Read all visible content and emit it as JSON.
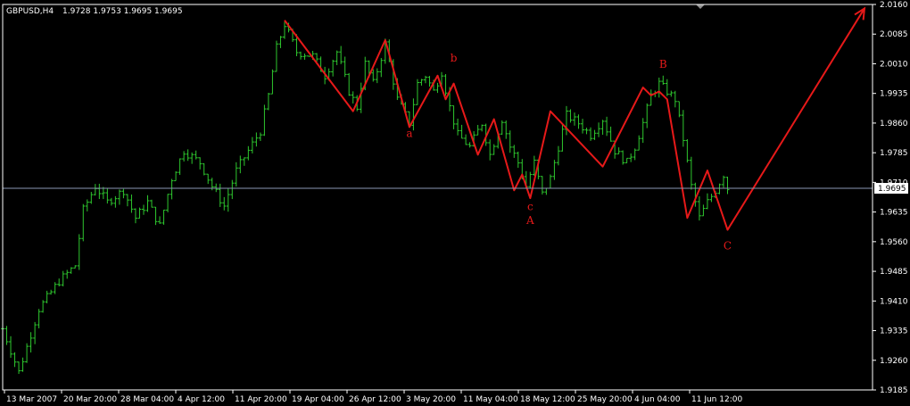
{
  "header": {
    "symbol_tf": "GBPUSD,H4",
    "ohlc": "1.9728 1.9753 1.9695 1.9695"
  },
  "colors": {
    "background": "#000000",
    "bars": "#2ec72e",
    "wave": "#e61919",
    "frame": "#ffffff",
    "bid_line": "#8a96b4",
    "price_box": "#ffffff"
  },
  "chart_data": {
    "type": "ohlc",
    "symbol": "GBPUSD",
    "timeframe": "H4",
    "ylim": [
      1.9185,
      2.016
    ],
    "y_ticks": [
      "2.0160",
      "2.0085",
      "2.0010",
      "1.9935",
      "1.9860",
      "1.9785",
      "1.9710",
      "1.9635",
      "1.9560",
      "1.9485",
      "1.9410",
      "1.9335",
      "1.9260",
      "1.9185"
    ],
    "x_ticks": [
      "13 Mar 2007",
      "20 Mar 20:00",
      "28 Mar 04:00",
      "4 Apr 12:00",
      "11 Apr 20:00",
      "19 Apr 04:00",
      "26 Apr 12:00",
      "3 May 20:00",
      "11 May 04:00",
      "18 May 12:00",
      "25 May 20:00",
      "4 Jun 04:00",
      "11 Jun 12:00"
    ],
    "current_price": 1.9695,
    "current_price_label": "1.9695",
    "price_path": [
      [
        0,
        1.934
      ],
      [
        4,
        1.923
      ],
      [
        9,
        1.939
      ],
      [
        14,
        1.946
      ],
      [
        18,
        1.95
      ],
      [
        20,
        1.964
      ],
      [
        23,
        1.97
      ],
      [
        26,
        1.966
      ],
      [
        30,
        1.969
      ],
      [
        33,
        1.962
      ],
      [
        36,
        1.966
      ],
      [
        39,
        1.96
      ],
      [
        42,
        1.972
      ],
      [
        45,
        1.979
      ],
      [
        49,
        1.976
      ],
      [
        52,
        1.97
      ],
      [
        55,
        1.965
      ],
      [
        58,
        1.974
      ],
      [
        61,
        1.979
      ],
      [
        64,
        1.984
      ],
      [
        66,
        1.993
      ],
      [
        68,
        2.005
      ],
      [
        70,
        2.011
      ],
      [
        73,
        2.004
      ],
      [
        77,
        2.003
      ],
      [
        80,
        1.998
      ],
      [
        83,
        2.004
      ],
      [
        86,
        1.994
      ],
      [
        88,
        1.99
      ],
      [
        90,
        2.001
      ],
      [
        92,
        1.996
      ],
      [
        95,
        2.006
      ],
      [
        98,
        1.992
      ],
      [
        101,
        1.986
      ],
      [
        103,
        1.996
      ],
      [
        105,
        1.998
      ],
      [
        107,
        1.994
      ],
      [
        109,
        1.999
      ],
      [
        111,
        1.99
      ],
      [
        113,
        1.983
      ],
      [
        116,
        1.98
      ],
      [
        119,
        1.986
      ],
      [
        121,
        1.978
      ],
      [
        124,
        1.987
      ],
      [
        126,
        1.98
      ],
      [
        128,
        1.976
      ],
      [
        130,
        1.97
      ],
      [
        132,
        1.976
      ],
      [
        134,
        1.968
      ],
      [
        136,
        1.972
      ],
      [
        138,
        1.98
      ],
      [
        140,
        1.988
      ],
      [
        143,
        1.986
      ],
      [
        146,
        1.983
      ],
      [
        149,
        1.987
      ],
      [
        152,
        1.979
      ],
      [
        155,
        1.976
      ],
      [
        157,
        1.98
      ],
      [
        159,
        1.986
      ],
      [
        161,
        1.993
      ],
      [
        163,
        1.996
      ],
      [
        165,
        1.994
      ],
      [
        167,
        1.992
      ],
      [
        169,
        1.982
      ],
      [
        171,
        1.97
      ],
      [
        173,
        1.962
      ],
      [
        175,
        1.966
      ],
      [
        177,
        1.969
      ],
      [
        179,
        1.973
      ],
      [
        180,
        1.9695
      ]
    ],
    "wave_path": [
      [
        70,
        2.012
      ],
      [
        87,
        1.989
      ],
      [
        95,
        2.007
      ],
      [
        101,
        1.985
      ],
      [
        108,
        1.998
      ],
      [
        110,
        1.992
      ],
      [
        112,
        1.996
      ],
      [
        118,
        1.978
      ],
      [
        122,
        1.987
      ],
      [
        127,
        1.969
      ],
      [
        129,
        1.973
      ],
      [
        131,
        1.967
      ],
      [
        136,
        1.989
      ],
      [
        149,
        1.975
      ],
      [
        159,
        1.995
      ],
      [
        161,
        1.993
      ],
      [
        163,
        1.994
      ],
      [
        165,
        1.992
      ],
      [
        170,
        1.962
      ],
      [
        175,
        1.974
      ],
      [
        180,
        1.959
      ],
      [
        214,
        2.015
      ]
    ],
    "x_max_index": 216,
    "annotations": [
      {
        "text": "a",
        "x": 101,
        "y": 1.9825
      },
      {
        "text": "b",
        "x": 112,
        "y": 2.0015
      },
      {
        "text": "c",
        "x": 131,
        "y": 1.964
      },
      {
        "text": "A",
        "x": 131,
        "y": 1.9605
      },
      {
        "text": "B",
        "x": 164,
        "y": 2.0
      },
      {
        "text": "C",
        "x": 180,
        "y": 1.954
      }
    ]
  }
}
